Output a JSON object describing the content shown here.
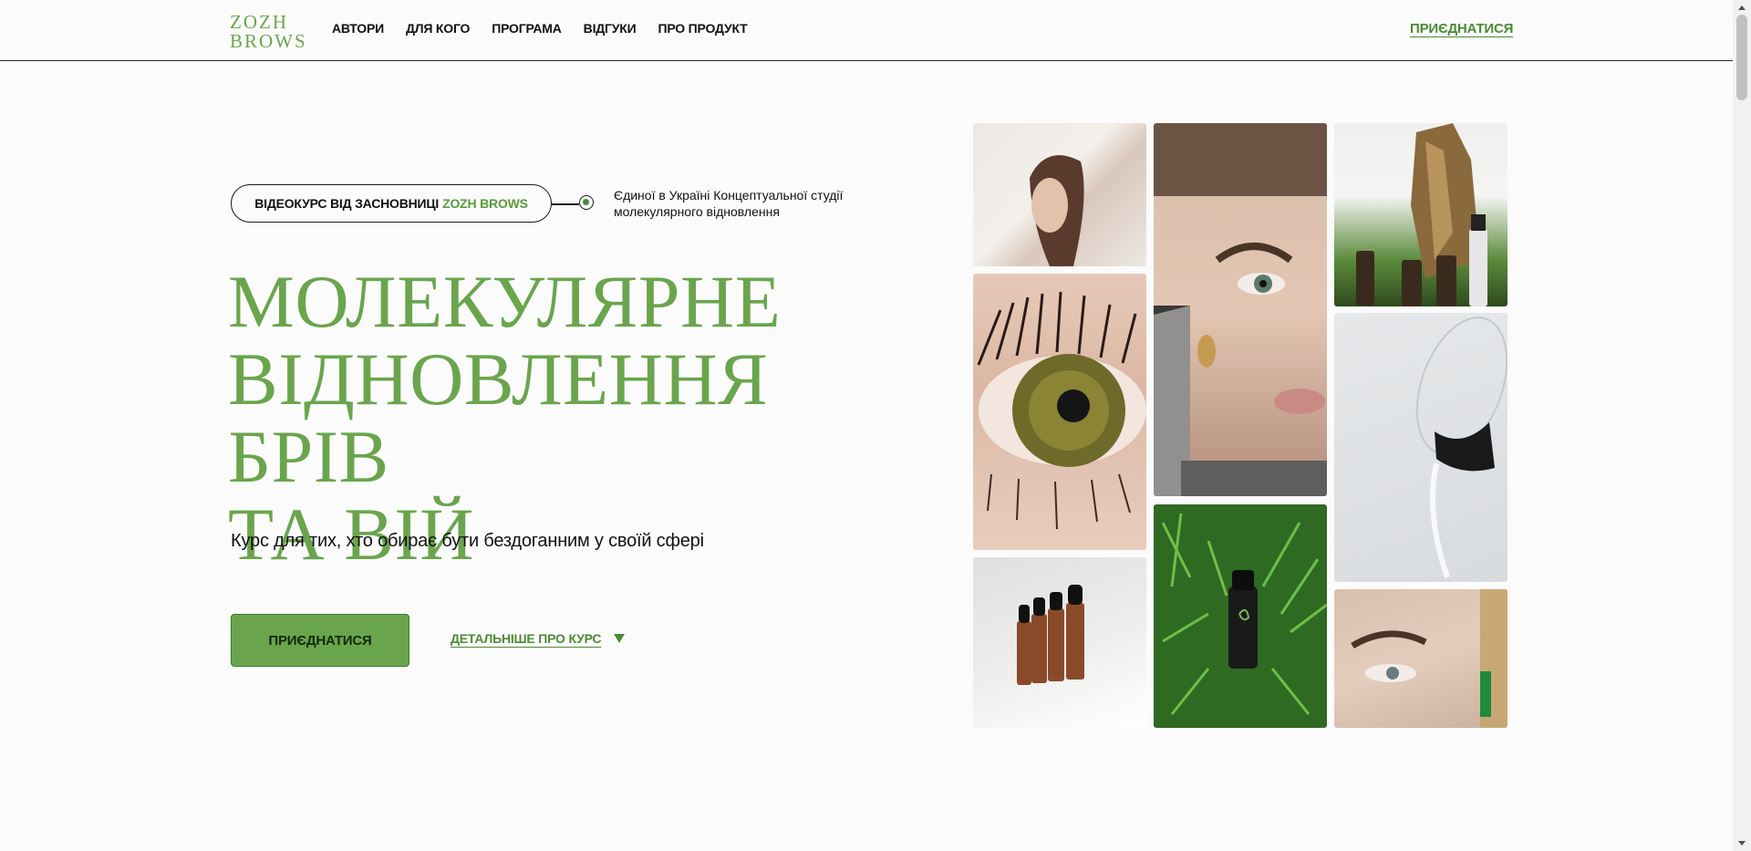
{
  "header": {
    "logo_line1": "ZOZH",
    "logo_line2": "BROWS",
    "nav": [
      "АВТОРИ",
      "ДЛЯ КОГО",
      "ПРОГРАМА",
      "ВІДГУКИ",
      "ПРО ПРОДУКТ"
    ],
    "join_label": "ПРИЄДНАТИСЯ"
  },
  "hero": {
    "pill_prefix": "ВІДЕОКУРС ВІД ЗАСНОВНИЦІ",
    "pill_brand": "ZOZH BROWS",
    "side_note": "Єдиної в Україні Концептуальної студії молекулярного відновлення",
    "title_line1": "МОЛЕКУЛЯРНЕ",
    "title_line2": "ВІДНОВЛЕННЯ БРІВ",
    "title_line3": "ТА ВІЙ",
    "subtitle": "Курс для тих, хто обирає бути бездоганним у своїй сфері",
    "cta_label": "ПРИЄДНАТИСЯ",
    "details_label": "ДЕТАЛЬНІШЕ ПРО КУРС"
  },
  "colors": {
    "accent": "#6aa54d",
    "accent_dark": "#4c8a36",
    "background": "#fbfbfb"
  },
  "gallery": [
    "woman-profile-photo",
    "woman-eye-closeup-photo",
    "serum-bottles-wood-photo",
    "green-eye-lashes-photo",
    "water-glass-pour-photo",
    "serum-bottles-row-photo",
    "serum-bottle-grass-photo",
    "woman-brow-closeup-photo"
  ]
}
